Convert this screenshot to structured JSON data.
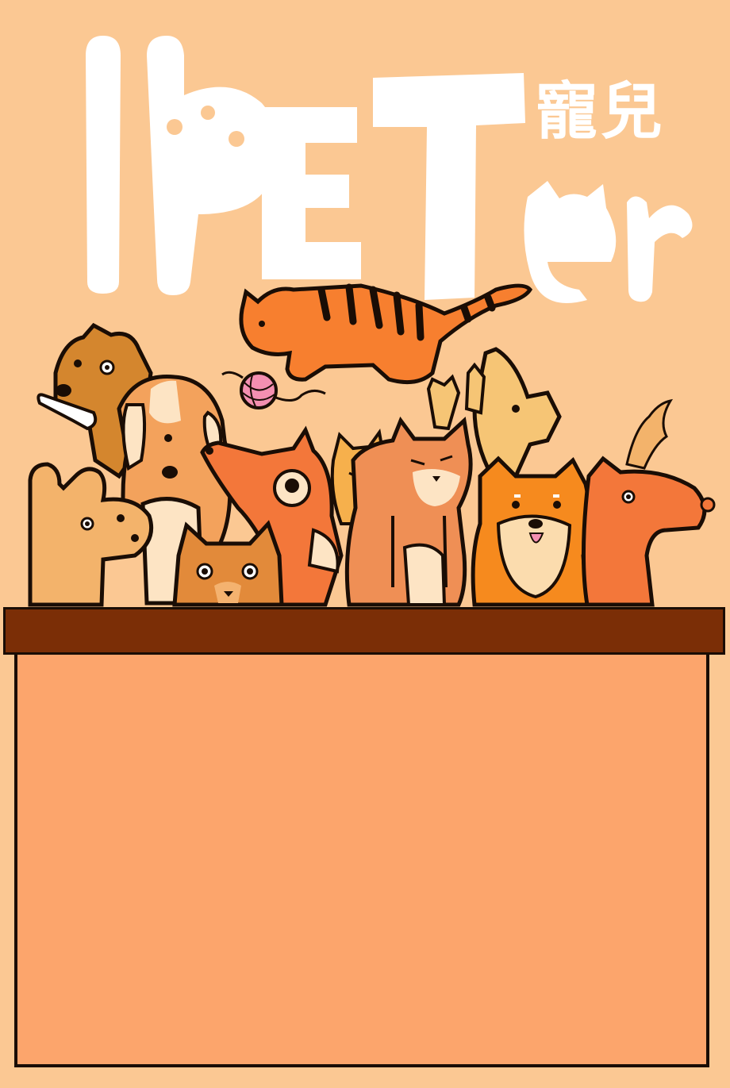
{
  "poster": {
    "logo_latin": "PETer",
    "logo_zh": "寵兒"
  },
  "colors": {
    "background": "#fbc893",
    "counter_top": "#7b2e06",
    "counter_body": "#fca56c",
    "outline": "#1a0d05",
    "logo": "#ffffff"
  },
  "animals": [
    {
      "name": "tabby-cat",
      "icon": "tiger-striped-cat-icon"
    },
    {
      "name": "yarn-ball",
      "icon": "yarn-ball-icon"
    },
    {
      "name": "dog-with-bone",
      "icon": "dog-bone-icon"
    },
    {
      "name": "beagle",
      "icon": "beagle-dog-icon"
    },
    {
      "name": "bunny-dog",
      "icon": "bunny-dog-icon"
    },
    {
      "name": "fox-dog",
      "icon": "fox-dog-icon"
    },
    {
      "name": "small-cat",
      "icon": "small-cat-icon"
    },
    {
      "name": "orange-cat",
      "icon": "orange-cat-icon"
    },
    {
      "name": "shiba",
      "icon": "shiba-dog-icon"
    },
    {
      "name": "horse-dog",
      "icon": "horse-dog-icon"
    },
    {
      "name": "howling-dog",
      "icon": "howling-dog-icon"
    }
  ]
}
